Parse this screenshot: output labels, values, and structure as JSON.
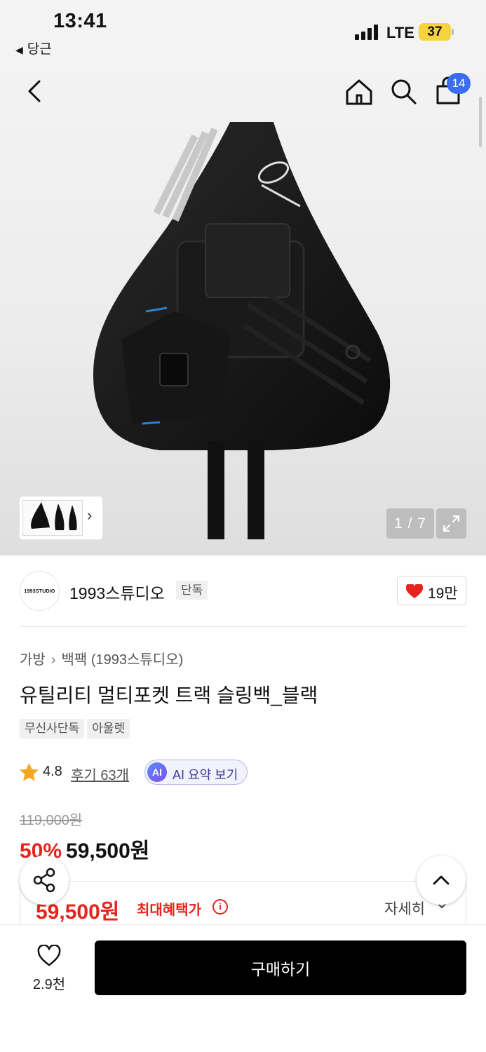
{
  "status_bar": {
    "time": "13:41",
    "back_app": "당근",
    "network": "LTE",
    "battery": "37"
  },
  "header": {
    "cart_count": "14",
    "icons": [
      "back-icon",
      "home-icon",
      "search-icon",
      "cart-icon"
    ]
  },
  "gallery": {
    "counter": "1 / 7",
    "thumb_chevron": "›"
  },
  "seller": {
    "logo_text": "1993STUDIO",
    "name": "1993스튜디오",
    "badge": "단독",
    "likes": "19만"
  },
  "product": {
    "breadcrumb": [
      "가방",
      "백팩 (1993스튜디오)"
    ],
    "title": "유틸리티 멀티포켓 트랙 슬링백_블랙",
    "tags": [
      "무신사단독",
      "아울렛"
    ],
    "rating": "4.8",
    "reviews": "후기 63개",
    "ai_icon": "AI",
    "ai_summary": "AI 요약 보기",
    "original_price": "119,000원",
    "discount": "50%",
    "sale_price": "59,500원"
  },
  "benefit": {
    "price": "59,500원",
    "label": "최대혜택가",
    "info_icon": "i",
    "detail": "자세히"
  },
  "bottom_bar": {
    "wish_count": "2.9천",
    "buy_label": "구매하기"
  },
  "colors": {
    "accent_red": "#e5241d",
    "badge_blue": "#3a6df0",
    "battery_yellow": "#f6d33e"
  }
}
